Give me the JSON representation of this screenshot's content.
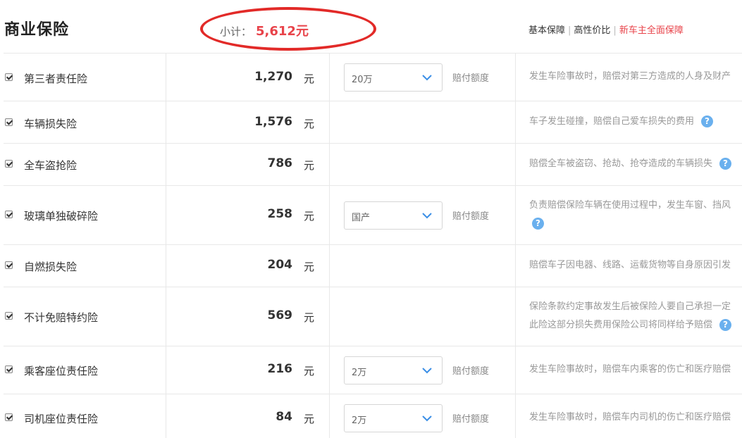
{
  "header": {
    "title": "商业保险",
    "subtotal_label": "小计：",
    "subtotal_amount": "5,612元",
    "filters": [
      {
        "label": "基本保障",
        "active": false
      },
      {
        "label": "高性价比",
        "active": false
      },
      {
        "label": "新车主全面保障",
        "active": true
      }
    ]
  },
  "rows": [
    {
      "name": "第三者责任险",
      "price": "1,270",
      "unit": "元",
      "select": "20万",
      "pay_label": "赔付额度",
      "desc": [
        "发生车险事故时，赔偿对第三方造成的人身及财产"
      ],
      "help": false
    },
    {
      "name": "车辆损失险",
      "price": "1,576",
      "unit": "元",
      "select": null,
      "pay_label": null,
      "desc": [
        "车子发生碰撞，赔偿自己爱车损失的费用"
      ],
      "help": true
    },
    {
      "name": "全车盗抢险",
      "price": "786",
      "unit": "元",
      "select": null,
      "pay_label": null,
      "desc": [
        "赔偿全车被盗窃、抢劫、抢夺造成的车辆损失"
      ],
      "help": true
    },
    {
      "name": "玻璃单独破碎险",
      "price": "258",
      "unit": "元",
      "select": "国产",
      "pay_label": "赔付额度",
      "desc": [
        "负责赔偿保险车辆在使用过程中，发生车窗、挡风"
      ],
      "help": true
    },
    {
      "name": "自燃损失险",
      "price": "204",
      "unit": "元",
      "select": null,
      "pay_label": null,
      "desc": [
        "赔偿车子因电器、线路、运载货物等自身原因引发"
      ],
      "help": false
    },
    {
      "name": "不计免赔特约险",
      "price": "569",
      "unit": "元",
      "select": null,
      "pay_label": null,
      "desc": [
        "保险条款约定事故发生后被保险人要自己承担一定",
        "此险这部分损失费用保险公司将同样给予赔偿"
      ],
      "help": true
    },
    {
      "name": "乘客座位责任险",
      "price": "216",
      "unit": "元",
      "select": "2万",
      "pay_label": "赔付额度",
      "desc": [
        "发生车险事故时，赔偿车内乘客的伤亡和医疗赔偿"
      ],
      "help": false
    },
    {
      "name": "司机座位责任险",
      "price": "84",
      "unit": "元",
      "select": "2万",
      "pay_label": "赔付额度",
      "desc": [
        "发生车险事故时，赔偿车内司机的伤亡和医疗赔偿"
      ],
      "help": false
    }
  ],
  "colors": {
    "accent_red": "#e8434a",
    "circle_red": "#e22a28",
    "help_blue": "#6ab0ee"
  }
}
